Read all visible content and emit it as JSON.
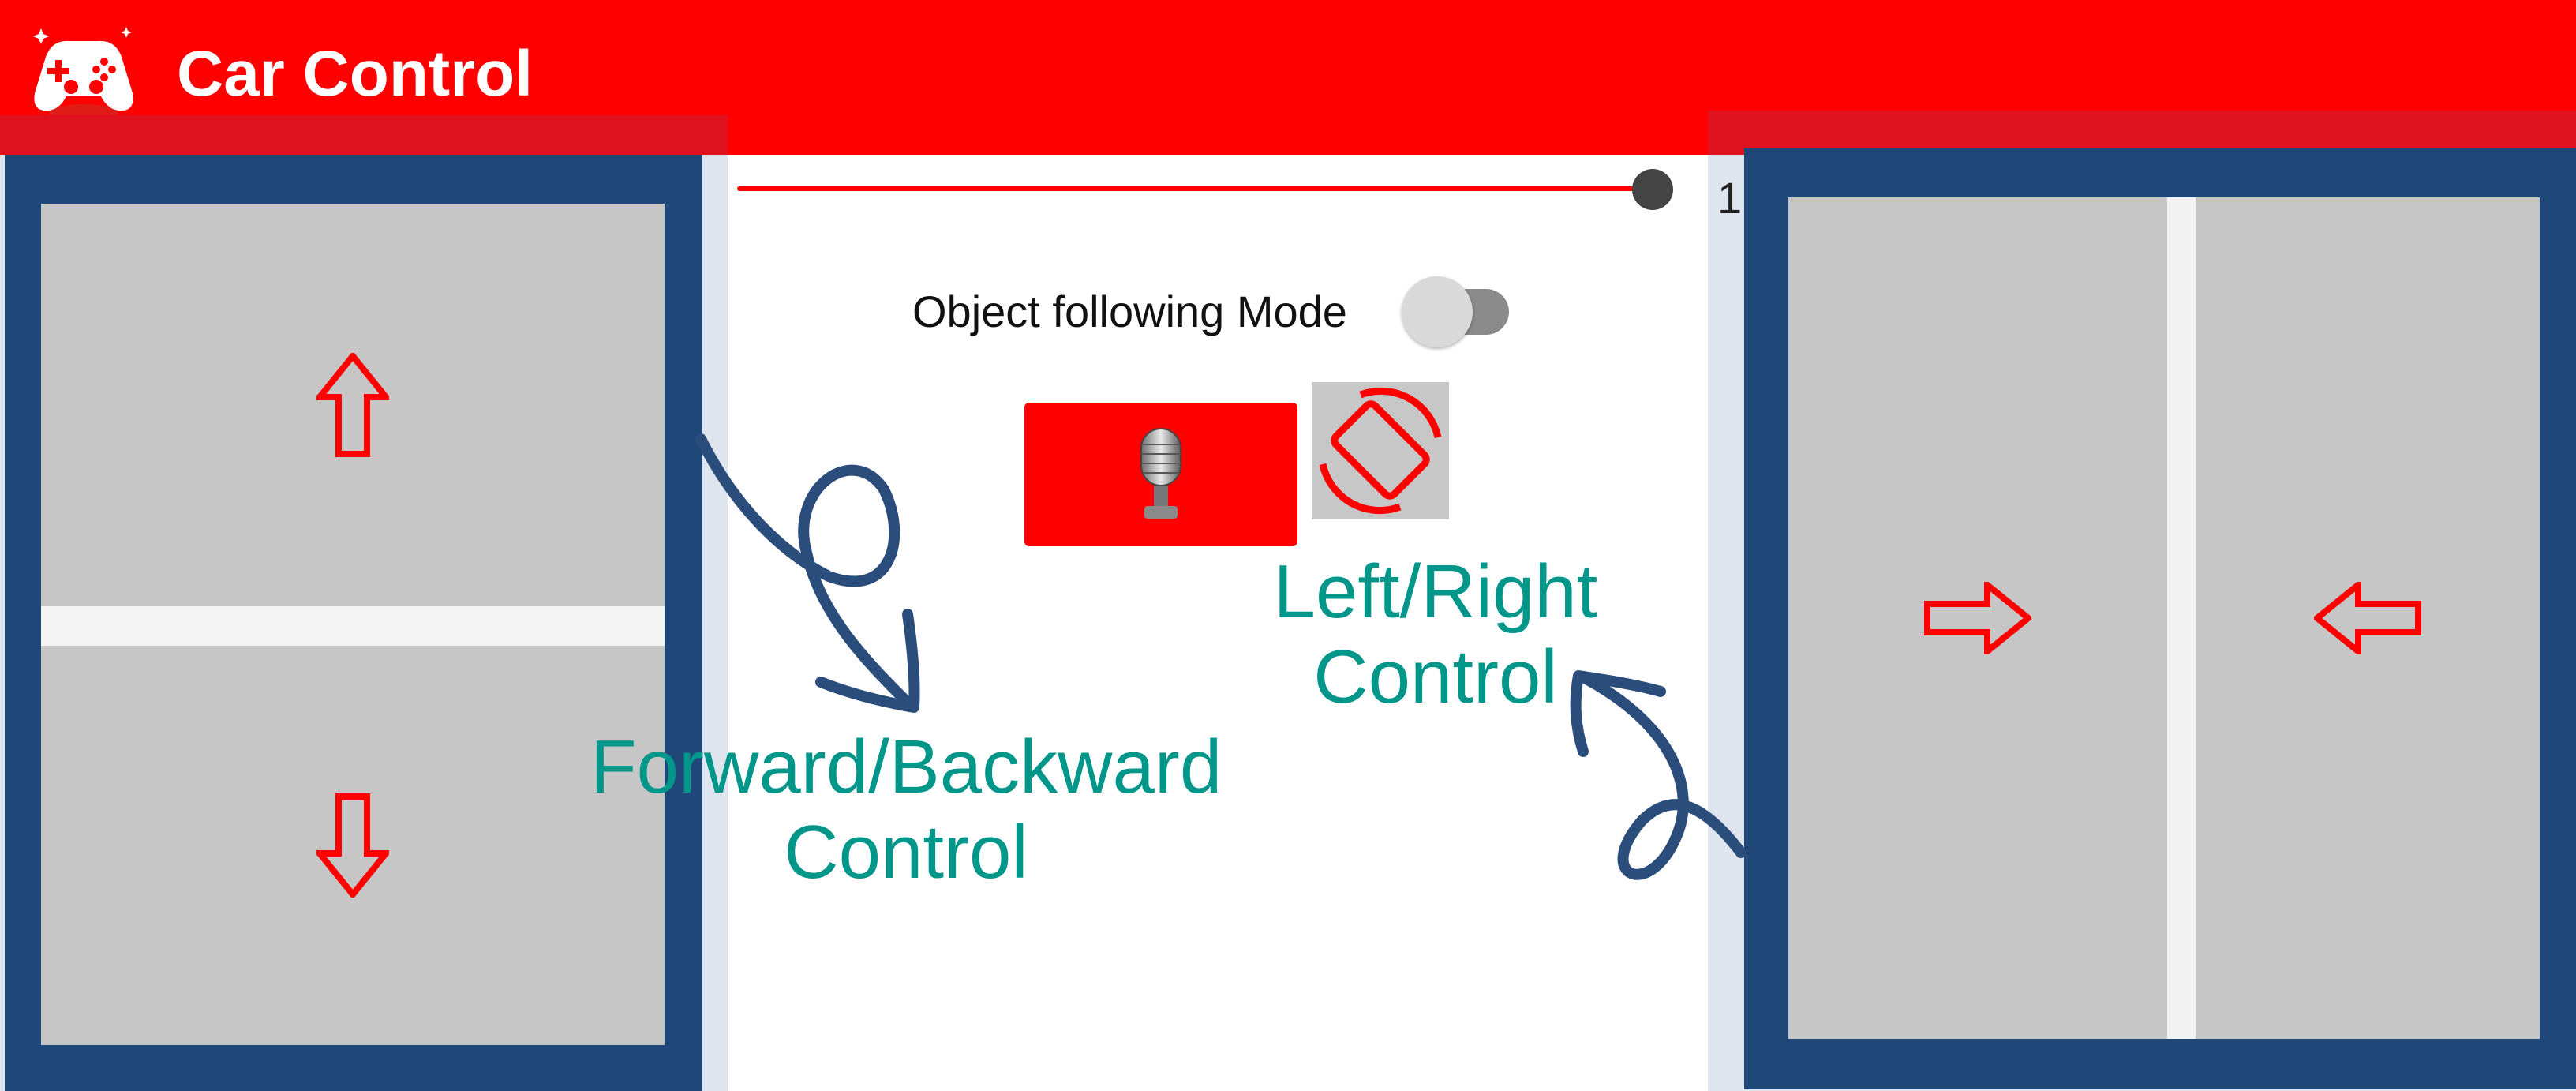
{
  "app": {
    "title": "Car Control",
    "icon": "gamepad-icon",
    "brand_color": "#ff0000"
  },
  "speed_slider": {
    "value": "1"
  },
  "object_following": {
    "label": "Object following Mode",
    "enabled": false
  },
  "buttons": {
    "voice": {
      "icon": "microphone-icon"
    },
    "rotate": {
      "icon": "screen-rotation-icon"
    }
  },
  "left_pad": {
    "forward_icon": "arrow-up-icon",
    "backward_icon": "arrow-down-icon"
  },
  "right_pad": {
    "right_icon": "arrow-right-icon",
    "left_icon": "arrow-left-icon"
  },
  "annotations": {
    "left_right_line1": "Left/Right",
    "left_right_line2": "Control",
    "forward_backward_line1": "Forward/Backward",
    "forward_backward_line2": "Control"
  },
  "colors": {
    "frame": "#1f4878",
    "pad": "#c6c6c6",
    "annotation": "#00968a",
    "arrow": "#ff0000"
  }
}
